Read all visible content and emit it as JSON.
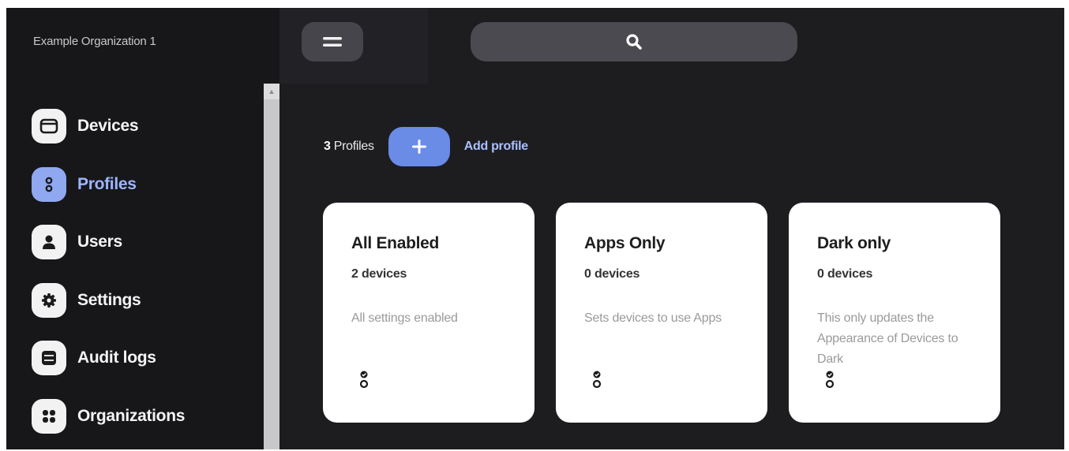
{
  "sidebar": {
    "org_name": "Example Organization 1",
    "items": [
      {
        "label": "Devices",
        "icon": "device-icon",
        "active": false
      },
      {
        "label": "Profiles",
        "icon": "profile-icon",
        "active": true
      },
      {
        "label": "Users",
        "icon": "user-icon",
        "active": false
      },
      {
        "label": "Settings",
        "icon": "gear-icon",
        "active": false
      },
      {
        "label": "Audit logs",
        "icon": "list-icon",
        "active": false
      },
      {
        "label": "Organizations",
        "icon": "grid-icon",
        "active": false
      }
    ]
  },
  "header": {
    "menu_icon": "hamburger-icon",
    "search_icon": "search-icon"
  },
  "main": {
    "profile_count": "3",
    "profile_count_label": "Profiles",
    "add_label": "Add profile",
    "cards": [
      {
        "title": "All Enabled",
        "devices": "2 devices",
        "description": "All settings enabled"
      },
      {
        "title": "Apps Only",
        "devices": "0 devices",
        "description": "Sets devices to use Apps"
      },
      {
        "title": "Dark only",
        "devices": "0 devices",
        "description": "This only updates the Appearance of Devices to Dark"
      }
    ]
  },
  "colors": {
    "background": "#1d1d20",
    "sidebar": "#17171a",
    "accent": "#6a8be6",
    "active_text": "#9db5ff",
    "card": "#ffffff"
  }
}
